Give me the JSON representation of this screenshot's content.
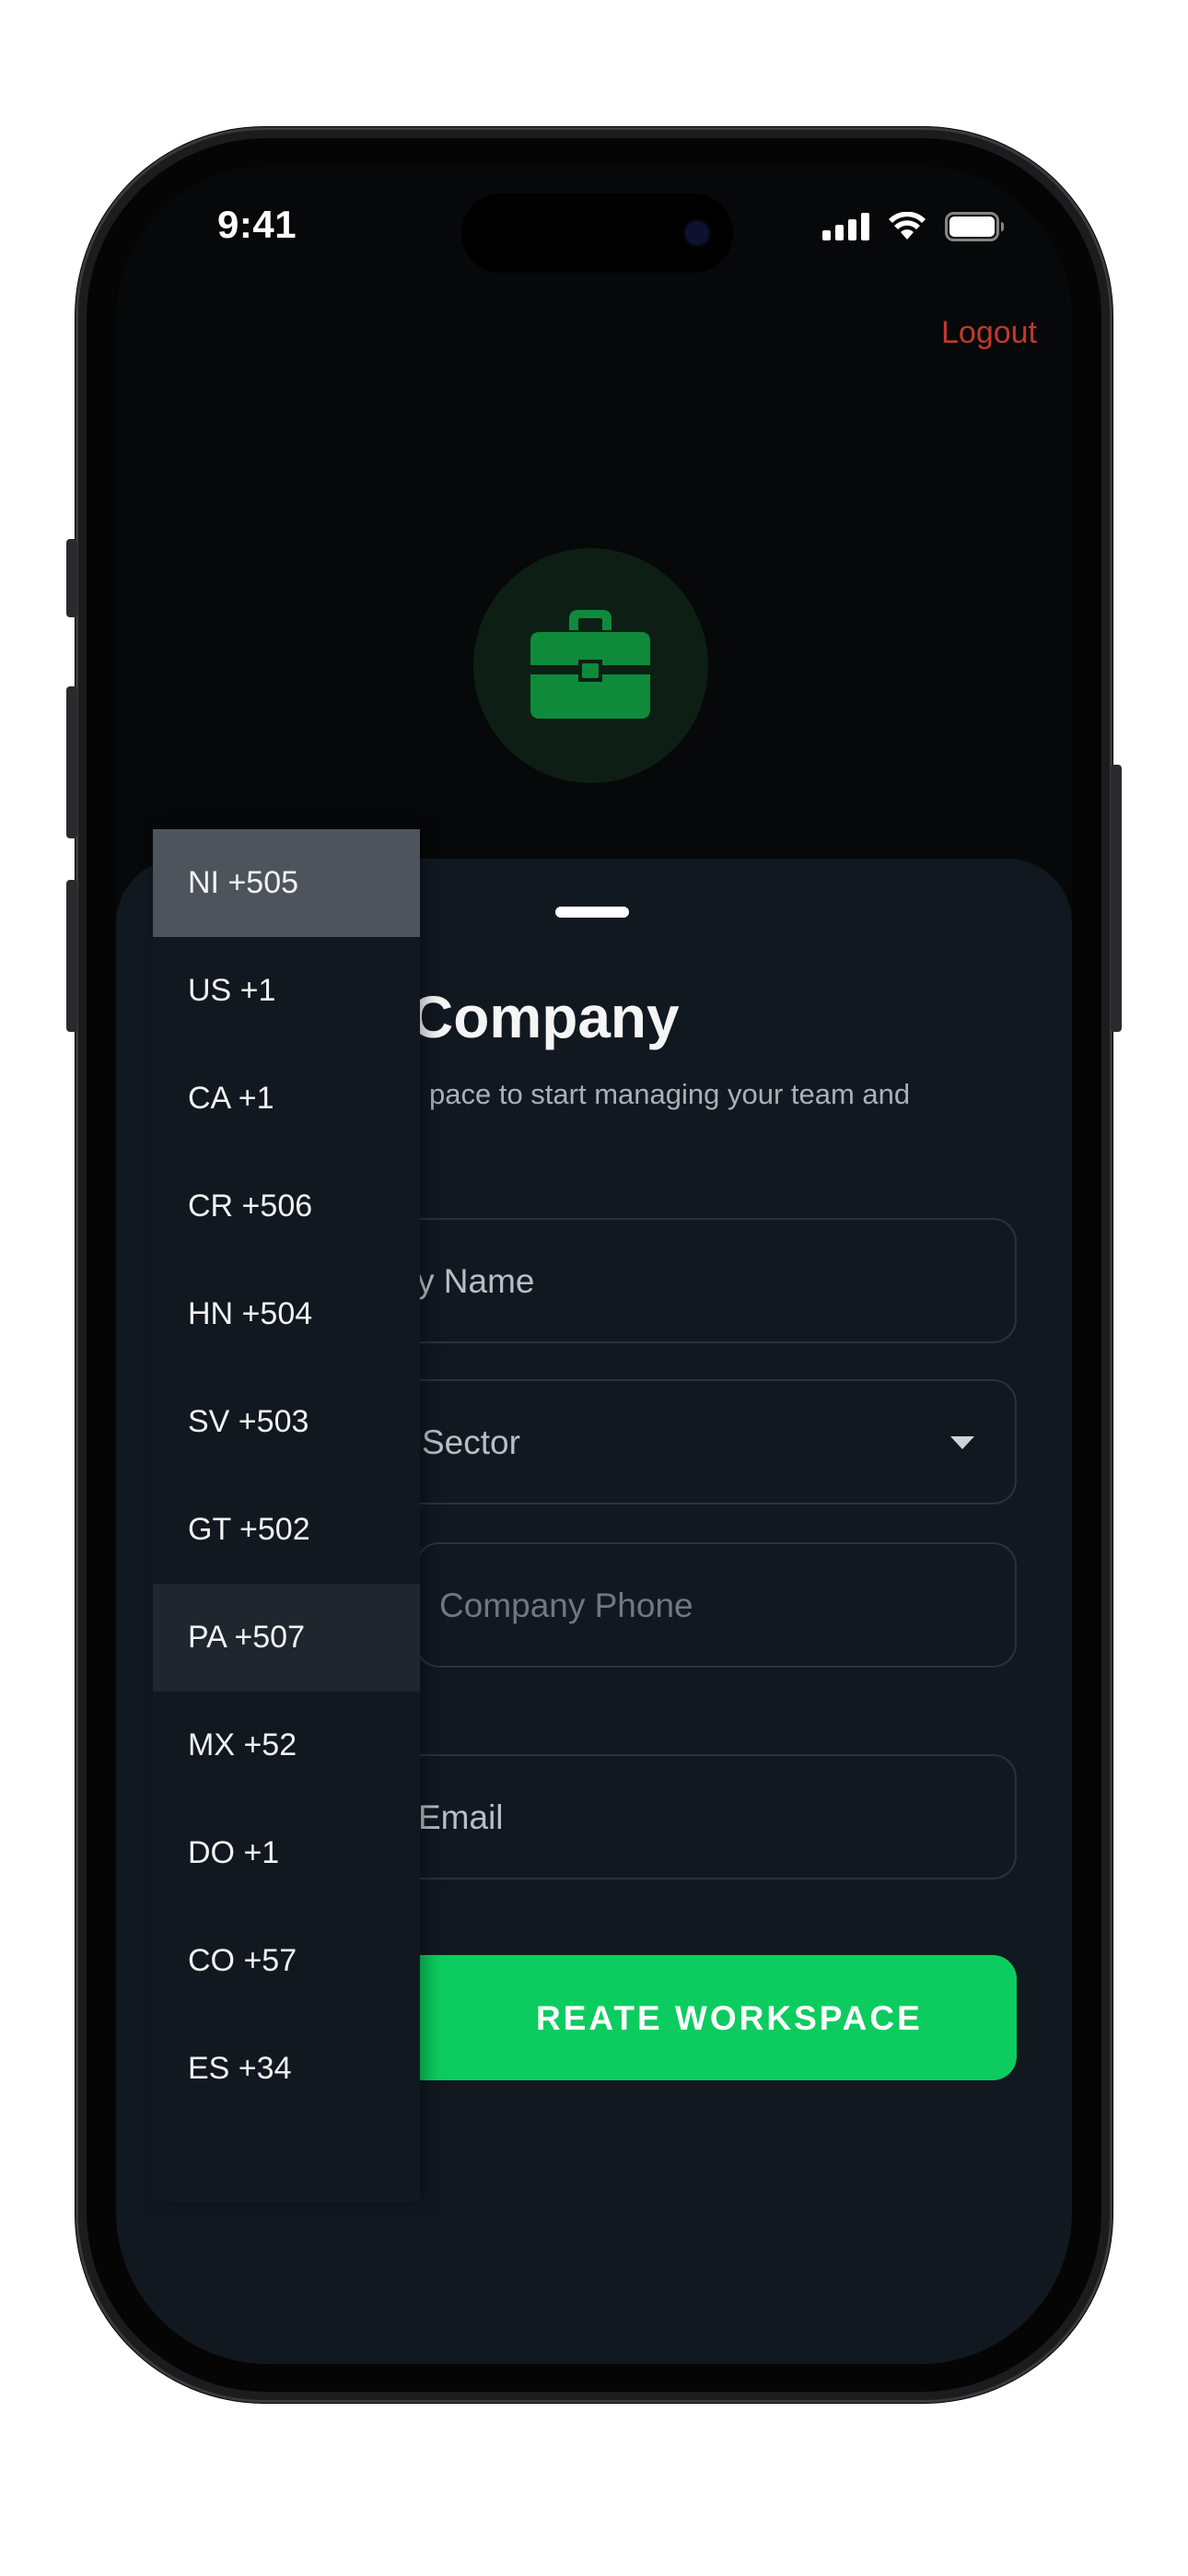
{
  "status_bar": {
    "time": "9:41",
    "icons": [
      "signal-icon",
      "wifi-icon",
      "battery-icon"
    ]
  },
  "header": {
    "logout_label": "Logout",
    "hero_icon": "briefcase-icon"
  },
  "sheet": {
    "title": "Company",
    "subtitle": "pace to start managing your team and",
    "fields": {
      "company_name": "y Name",
      "sector": "Sector",
      "phone_placeholder": "Company Phone",
      "email": "Email"
    },
    "create_label": "REATE WORKSPACE"
  },
  "country_dropdown": {
    "selected_index": 0,
    "hovered_index": 7,
    "options": [
      "NI +505",
      "US +1",
      "CA +1",
      "CR +506",
      "HN +504",
      "SV +503",
      "GT +502",
      "PA +507",
      "MX +52",
      "DO +1",
      "CO +57",
      "ES +34"
    ]
  },
  "colors": {
    "accent": "#0ccc5f",
    "logout": "#c0392b",
    "sheet_bg": "#111820",
    "screen_bg": "#070809"
  }
}
